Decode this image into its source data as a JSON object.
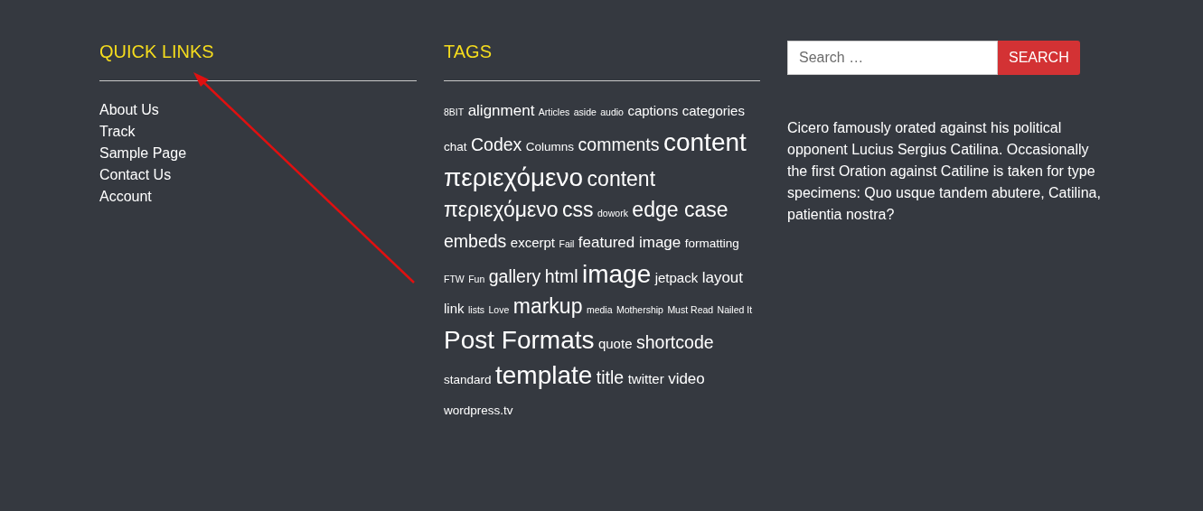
{
  "quick_links": {
    "title": "QUICK LINKS",
    "items": [
      "About Us",
      "Track",
      "Sample Page",
      "Contact Us",
      "Account"
    ]
  },
  "tags": {
    "title": "TAGS",
    "items": [
      {
        "label": "8BIT",
        "kind": "tiny"
      },
      {
        "label": "alignment",
        "kind": "large"
      },
      {
        "label": "Articles",
        "kind": "tiny"
      },
      {
        "label": "aside",
        "kind": "tiny"
      },
      {
        "label": "audio",
        "kind": "tiny"
      },
      {
        "label": "captions",
        "kind": "medium"
      },
      {
        "label": "categories",
        "kind": "medium"
      },
      {
        "label": "chat",
        "kind": "small"
      },
      {
        "label": "Codex",
        "kind": "larger"
      },
      {
        "label": "Columns",
        "kind": "small"
      },
      {
        "label": "comments",
        "kind": "larger"
      },
      {
        "label": "content",
        "kind": "giant"
      },
      {
        "label": "περιεχόμενο",
        "kind": "giant"
      },
      {
        "label": "content",
        "kind": "huge"
      },
      {
        "label": "περιεχόμενο",
        "kind": "huge"
      },
      {
        "label": "css",
        "kind": "huge"
      },
      {
        "label": "dowork",
        "kind": "tiny"
      },
      {
        "label": "edge case",
        "kind": "huge"
      },
      {
        "label": "embeds",
        "kind": "larger"
      },
      {
        "label": "excerpt",
        "kind": "medium"
      },
      {
        "label": "Fail",
        "kind": "tiny"
      },
      {
        "label": "featured image",
        "kind": "large"
      },
      {
        "label": "formatting",
        "kind": "small"
      },
      {
        "label": "FTW",
        "kind": "tiny"
      },
      {
        "label": "Fun",
        "kind": "tiny"
      },
      {
        "label": "gallery",
        "kind": "larger"
      },
      {
        "label": "html",
        "kind": "larger"
      },
      {
        "label": "image",
        "kind": "giant"
      },
      {
        "label": "jetpack",
        "kind": "medium"
      },
      {
        "label": "layout",
        "kind": "large"
      },
      {
        "label": "link",
        "kind": "medium"
      },
      {
        "label": "lists",
        "kind": "tiny"
      },
      {
        "label": "Love",
        "kind": "tiny"
      },
      {
        "label": "markup",
        "kind": "huge"
      },
      {
        "label": "media",
        "kind": "tiny"
      },
      {
        "label": "Mothership",
        "kind": "tiny"
      },
      {
        "label": "Must Read",
        "kind": "tiny"
      },
      {
        "label": "Nailed It",
        "kind": "tiny"
      },
      {
        "label": "Post Formats",
        "kind": "giant"
      },
      {
        "label": "quote",
        "kind": "medium"
      },
      {
        "label": "shortcode",
        "kind": "larger"
      },
      {
        "label": "standard",
        "kind": "small"
      },
      {
        "label": "template",
        "kind": "giant"
      },
      {
        "label": "title",
        "kind": "larger"
      },
      {
        "label": "twitter",
        "kind": "medium"
      },
      {
        "label": "video",
        "kind": "large"
      },
      {
        "label": "wordpress.tv",
        "kind": "small"
      }
    ]
  },
  "search": {
    "placeholder": "Search …",
    "button": "SEARCH"
  },
  "text": "Cicero famously orated against his political opponent Lucius Sergius Catilina. Occasionally the first Oration against Catiline is taken for type specimens: Quo usque tandem abutere, Catilina, patientia nostra?"
}
